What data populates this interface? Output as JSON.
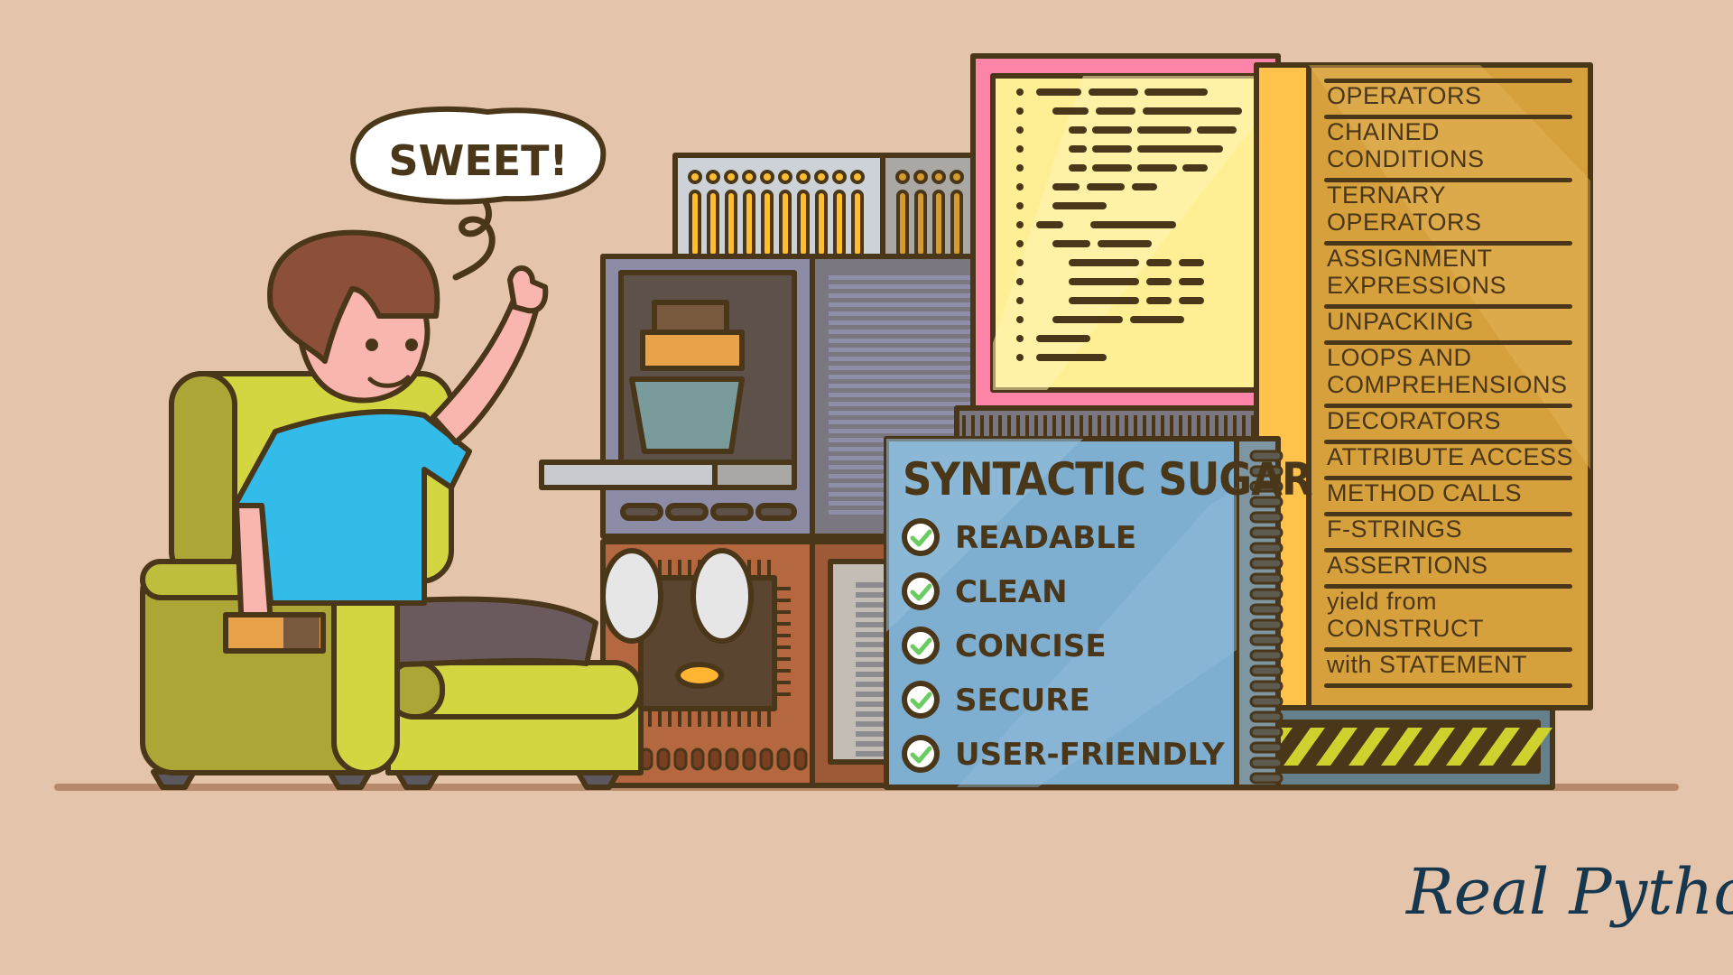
{
  "speech_bubble": {
    "text": "SWEET!"
  },
  "sign": {
    "title": "SYNTACTIC SUGAR",
    "items": [
      {
        "label": "READABLE",
        "checked": true
      },
      {
        "label": "CLEAN",
        "checked": true
      },
      {
        "label": "CONCISE",
        "checked": true
      },
      {
        "label": "SECURE",
        "checked": true
      },
      {
        "label": "USER-FRIENDLY",
        "checked": true
      }
    ]
  },
  "feature_list": {
    "items": [
      {
        "lines": [
          "OPERATORS"
        ]
      },
      {
        "lines": [
          "CHAINED",
          "CONDITIONS"
        ]
      },
      {
        "lines": [
          "TERNARY",
          "OPERATORS"
        ]
      },
      {
        "lines": [
          "ASSIGNMENT",
          "EXPRESSIONS"
        ]
      },
      {
        "lines": [
          "UNPACKING"
        ]
      },
      {
        "lines": [
          "LOOPS AND",
          "COMPREHENSIONS"
        ]
      },
      {
        "lines": [
          "DECORATORS"
        ]
      },
      {
        "lines": [
          "ATTRIBUTE ACCESS"
        ]
      },
      {
        "lines": [
          "METHOD CALLS"
        ]
      },
      {
        "lines": [
          "F-STRINGS"
        ]
      },
      {
        "lines": [
          "ASSERTIONS"
        ]
      },
      {
        "lines": [
          "yield from",
          "CONSTRUCT"
        ]
      },
      {
        "lines": [
          "with STATEMENT"
        ]
      }
    ]
  },
  "logo": {
    "text": "Real Python"
  },
  "colors": {
    "background": "#e4c5ab",
    "outline": "#4a3619",
    "chair": "#d3d641",
    "chair_shade": "#aca636",
    "shirt": "#33bbe9",
    "hair": "#8b4f3a",
    "skin": "#f8b6ae",
    "monitor_frame": "#ff85a8",
    "code_screen": "#ffef94",
    "list_panel": "#d6a13d",
    "sign": "#7eaed0",
    "check": "#6ccc62",
    "hazard": "#cfd22e",
    "logo": "#17374f"
  }
}
